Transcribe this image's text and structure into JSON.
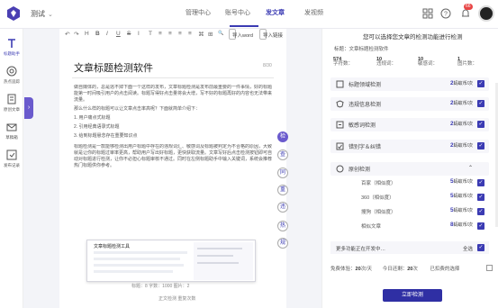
{
  "header": {
    "workspace": "测试",
    "nav": [
      {
        "label": "管理中心"
      },
      {
        "label": "账号中心"
      },
      {
        "label": "发文章"
      },
      {
        "label": "发视频"
      }
    ],
    "notification_count": "66"
  },
  "sidebar": {
    "items": [
      {
        "label": "标题助手",
        "icon": "title-icon"
      },
      {
        "label": "热点追踪",
        "icon": "target-icon"
      },
      {
        "label": "原创文章",
        "icon": "document-icon"
      },
      {
        "label": "草稿箱",
        "icon": "drafts-icon"
      },
      {
        "label": "发布记录",
        "icon": "publish-record-icon"
      }
    ]
  },
  "editor": {
    "toolbar": {
      "tools": [
        "↶",
        "↷",
        "H",
        "B",
        "I",
        "U",
        "S",
        "I",
        "T",
        "≡",
        "≡",
        "≡",
        "≡",
        "⌘",
        "⊞",
        "🔍"
      ],
      "import_word": "导入word",
      "import_link": "导入链接"
    },
    "title": "文章标题检测软件",
    "word_count": "8/30",
    "paragraphs": [
      "做自媒体的，总是逃不掉下面一个这样的发布，文章标题检测是发布前最重要的一件事情，好的标题能第一时间吸引用户的点击阅读。标题写得好点击量将会大增，写不好的标题再好的内容也无法带来流量。",
      "那么什么样的标题可以让文章点击率高呢？下面就简单介绍下：",
      "1. 用户痛点式标题",
      "2. 引用经典语录式标题",
      "3. 给到标题悬念存在重要知识点",
      "标题检测是一款能够检测出用户标题中存在的违规词汇、敏感词及标题被判定为不合格的原因，大致就是让你的标题过审率更高，帮助用户写出好标题，更快获取流量。文章写好后点击检测按钮即可自动对标题进行检测，让你不必担心标题审核不通过。同时在左侧标题助手中输入关键词，系统会推荐热门标题供你参考。"
    ],
    "embedded_title": "文章标题检测工具",
    "stats": "标题：8    字数：1000    图片：2",
    "stats2": "正文检测     重复次数"
  },
  "rail": [
    "检",
    "查",
    "同",
    "重",
    "违",
    "热",
    "规"
  ],
  "panel": {
    "title": "您可以选择您文章的检测功能进行检测",
    "subtitle": "标题：文章标题检测软件",
    "stats": [
      {
        "label": "字符数：",
        "value": "574"
      },
      {
        "label": "违规词：",
        "value": "10"
      },
      {
        "label": "敏感词：",
        "value": "10"
      },
      {
        "label": "图片数：",
        "value": "1"
      }
    ],
    "cards": [
      {
        "label": "标题领域检测",
        "value": "2",
        "unit": "蚂蚁币/次"
      },
      {
        "label": "违规信息检测",
        "value": "2",
        "unit": "蚂蚁币/次"
      },
      {
        "label": "敏感词检测",
        "value": "2",
        "unit": "蚂蚁币/次"
      },
      {
        "label": "错别字＆纠错",
        "value": "2",
        "unit": "蚂蚁币/次"
      },
      {
        "label": "原创检测",
        "value": "",
        "unit": ""
      }
    ],
    "sub_rows": [
      {
        "label": "百家（相似度）",
        "value": "5",
        "unit": "蚂蚁币/次"
      },
      {
        "label": "360（相似度）",
        "value": "5",
        "unit": "蚂蚁币/次"
      },
      {
        "label": "搜狗（相似度）",
        "value": "5",
        "unit": "蚂蚁币/次"
      },
      {
        "label": "相似文章",
        "value": "8",
        "unit": "蚂蚁币/次"
      }
    ],
    "more": "更多功能正在开发中…",
    "select_all": "全选",
    "quota": {
      "free_label": "免费体验：",
      "free_value": "20",
      "free_unit": "次/天",
      "today_label": "今日还剩：",
      "today_value": "20",
      "today_unit": "次"
    },
    "autodeduct": "已扣费的选择",
    "submit": "立即检测"
  }
}
